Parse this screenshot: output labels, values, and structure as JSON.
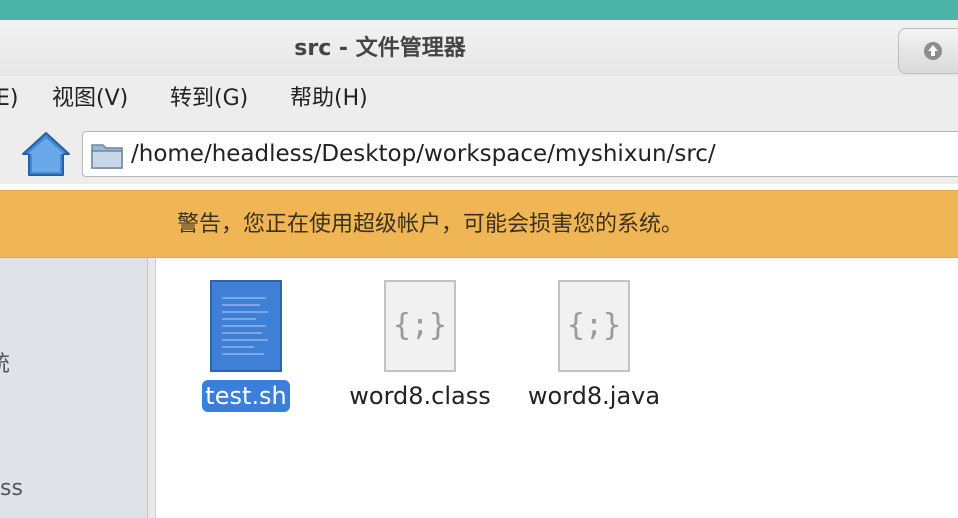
{
  "window": {
    "title": "src - 文件管理器"
  },
  "menubar": {
    "items": [
      {
        "label": "E)"
      },
      {
        "label": "视图(V)"
      },
      {
        "label": "转到(G)"
      },
      {
        "label": "帮助(H)"
      }
    ]
  },
  "location": {
    "path": "/home/headless/Desktop/workspace/myshixun/src/"
  },
  "warning": {
    "text": "警告，您正在使用超级帐户，可能会损害您的系统。"
  },
  "sidebar": {
    "fragments": [
      "统",
      "ss"
    ]
  },
  "files": [
    {
      "name": "test.sh",
      "icon": "shell-script-icon",
      "selected": true
    },
    {
      "name": "word8.class",
      "icon": "code-file-icon",
      "selected": false
    },
    {
      "name": "word8.java",
      "icon": "code-file-icon",
      "selected": false
    }
  ],
  "colors": {
    "desktop": "#4bb4a6",
    "warning": "#f0b656",
    "selection": "#3a7fd9",
    "sidebar": "#dfe3e8"
  }
}
